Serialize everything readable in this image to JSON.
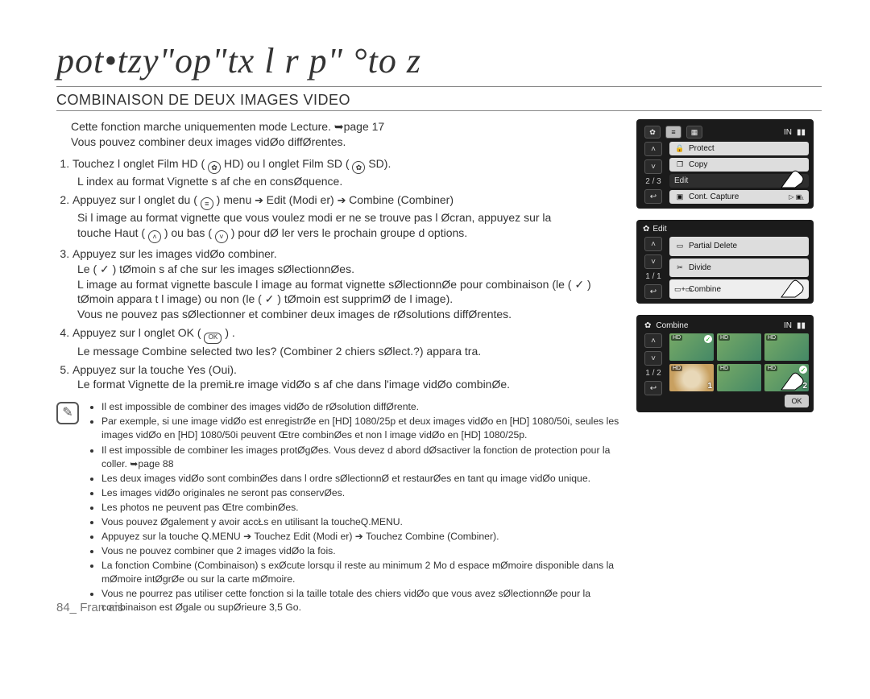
{
  "chapter_title": "pot•tzy\"op\"tx l r p\" °to z",
  "section_title": "COMBINAISON DE DEUX IMAGES VIDEO",
  "intro_line1": "Cette fonction marche uniquementen mode Lecture. ➥page 17",
  "intro_line2": "Vous pouvez combiner deux images vidØo diffØrentes.",
  "steps": {
    "s1_a": "Touchez l onglet Film HD (",
    "s1_mid1": "HD) ou l onglet Film SD (",
    "s1_end": "SD).",
    "s1_sub": "L index au format Vignette s af che en consØquence.",
    "s2_a": "Appuyez sur l onglet du (",
    "s2_b": ") menu",
    "s2_mid1": "Edit  (Modi   er)",
    "s2_mid2": "Combine   (Combiner)",
    "s2_sub1a": "Si l image au format vignette que vous voulez modi er ne se trouve pas   l Øcran, appuyez sur la",
    "s2_sub1b": "touche Haut (",
    "s2_sub1c": ") ou bas (",
    "s2_sub1d": ") pour dØ ler vers le prochain groupe d options.",
    "s3": "Appuyez sur les images vidØo   combiner.",
    "s3_sub1": "Le ( ✓ ) tØmoin s af che sur les images sØlectionnØes.",
    "s3_sub2": "L image au format vignette bascule l image au format vignette sØlectionnØe pour combinaison (le ( ✓ ) tØmoin appara t   l image) ou non (le ( ✓ ) tØmoin est supprimØ de l image).",
    "s3_sub3": "Vous ne pouvez pas sØlectionner et combiner deux images de rØsolutions diffØrentes.",
    "s4_a": "Appuyez sur l onglet OK (",
    "s4_b": ") .",
    "s4_sub": "Le message  Combine selected two  les?  (Combiner 2         chiers sØlect.?) appara tra.",
    "s5": "Appuyez sur la touche  Yes  (Oui).",
    "s5_sub": "Le format Vignette de la premiŁre image vidØo s af che dans l'image vidØo combinØe."
  },
  "notes": [
    "Il est impossible de combiner des images vidØo de rØsolution diffØrente.",
    "Par exemple, si une image vidØo est enregistrØe en [HD] 1080/25p et deux images vidØo en [HD] 1080/50i, seules les images vidØo en [HD] 1080/50i peuvent Œtre combinØes et non l image vidØo en [HD] 1080/25p.",
    "Il est impossible de combiner les images protØgØes. Vous devez d abord dØsactiver la fonction de protection pour la coller. ➥page 88",
    "Les deux images vidØo sont combinØes dans l ordre sØlectionnØ et restaurØes en tant qu image vidØo unique.",
    "Les images vidØo originales ne seront pas conservØes.",
    "Les photos ne peuvent pas Œtre combinØes.",
    "Vous pouvez Øgalement y avoir accŁs en utilisant la toucheQ.MENU.",
    "Appuyez sur la touche Q.MENU ➔ Touchez  Edit  (Modi    er) ➔ Touchez  Combine  (Combiner).",
    "Vous ne pouvez combiner que 2 images vidØo   la fois.",
    "La fonction Combine (Combinaison) s exØcute lorsqu il reste au minimum 2 Mo d espace mØmoire disponible dans la mØmoire intØgrØe ou sur la carte mØmoire.",
    "Vous ne pourrez pas utiliser cette fonction si la taille totale des  chiers vidØo que vous avez sØlectionnØe pour la combinaison est Øgale ou supØrieure   3,5 Go."
  ],
  "footer": "84_ Fran ais",
  "lcd1": {
    "counter": "2 / 3",
    "items": [
      "Protect",
      "Copy",
      "Edit",
      "Cont. Capture"
    ]
  },
  "lcd2": {
    "title": "Edit",
    "counter": "1 / 1",
    "items": [
      "Partial Delete",
      "Divide",
      "Combine"
    ]
  },
  "lcd3": {
    "title": "Combine",
    "counter": "1 / 2",
    "ok": "OK",
    "hd": "HD"
  }
}
